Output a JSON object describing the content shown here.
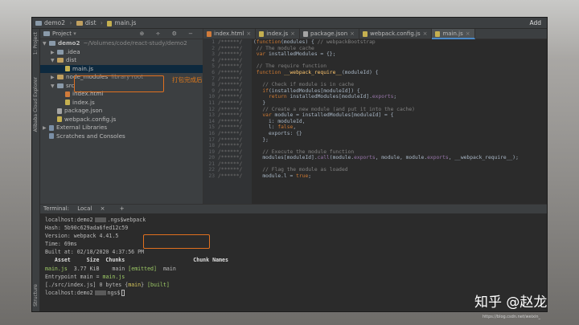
{
  "titlebar": {
    "crumb1": "demo2",
    "crumb2": "dist",
    "crumb3": "main.js",
    "right_label": "Add"
  },
  "leftbar": {
    "label1": "1: Project",
    "label2": "Alibaba Cloud Explorer",
    "label3": "Structure"
  },
  "project": {
    "header_label": "Project",
    "tools": "⊕ ÷ ⚙ −",
    "tree": [
      {
        "indent": 0,
        "arrow": "▼",
        "icon": "folder",
        "label": "demo2",
        "extra": "~/Volumes/code/react-study/demo2",
        "bold": true
      },
      {
        "indent": 1,
        "arrow": "▶",
        "icon": "folder",
        "label": ".idea",
        "extra": ""
      },
      {
        "indent": 1,
        "arrow": "▼",
        "icon": "folder-y",
        "label": "dist",
        "extra": ""
      },
      {
        "indent": 2,
        "arrow": "",
        "icon": "js",
        "label": "main.js",
        "extra": "",
        "selected": true
      },
      {
        "indent": 1,
        "arrow": "▶",
        "icon": "folder-y",
        "label": "node_modules",
        "extra": "library root"
      },
      {
        "indent": 1,
        "arrow": "▼",
        "icon": "folder",
        "label": "src",
        "extra": ""
      },
      {
        "indent": 2,
        "arrow": "",
        "icon": "html",
        "label": "index.html",
        "extra": ""
      },
      {
        "indent": 2,
        "arrow": "",
        "icon": "js",
        "label": "index.js",
        "extra": ""
      },
      {
        "indent": 1,
        "arrow": "",
        "icon": "json",
        "label": "package.json",
        "extra": ""
      },
      {
        "indent": 1,
        "arrow": "",
        "icon": "js",
        "label": "webpack.config.js",
        "extra": ""
      },
      {
        "indent": 0,
        "arrow": "▶",
        "icon": "lib",
        "label": "External Libraries",
        "extra": ""
      },
      {
        "indent": 0,
        "arrow": "",
        "icon": "lib",
        "label": "Scratches and Consoles",
        "extra": ""
      }
    ],
    "annotation": "打包完成后"
  },
  "editor": {
    "tabs": [
      {
        "label": "index.html",
        "active": false
      },
      {
        "label": "index.js",
        "active": false
      },
      {
        "label": "package.json",
        "active": false
      },
      {
        "label": "webpack.config.js",
        "active": false
      },
      {
        "label": "main.js",
        "active": true
      }
    ],
    "gutter_mark": "/******/",
    "lines": [
      {
        "n": "1",
        "code": "(function(modules) { // webpackBootstrap"
      },
      {
        "n": "2",
        "code": " // The module cache"
      },
      {
        "n": "3",
        "code": " var installedModules = {};"
      },
      {
        "n": "4",
        "code": ""
      },
      {
        "n": "5",
        "code": " // The require function"
      },
      {
        "n": "6",
        "code": " function __webpack_require__(moduleId) {"
      },
      {
        "n": "7",
        "code": ""
      },
      {
        "n": "8",
        "code": "   // Check if module is in cache"
      },
      {
        "n": "9",
        "code": "   if(installedModules[moduleId]) {"
      },
      {
        "n": "10",
        "code": "     return installedModules[moduleId].exports;"
      },
      {
        "n": "11",
        "code": "   }"
      },
      {
        "n": "12",
        "code": "   // Create a new module (and put it into the cache)"
      },
      {
        "n": "13",
        "code": "   var module = installedModules[moduleId] = {"
      },
      {
        "n": "14",
        "code": "     i: moduleId,"
      },
      {
        "n": "15",
        "code": "     l: false,"
      },
      {
        "n": "16",
        "code": "     exports: {}"
      },
      {
        "n": "17",
        "code": "   };"
      },
      {
        "n": "18",
        "code": ""
      },
      {
        "n": "19",
        "code": "   // Execute the module function"
      },
      {
        "n": "20",
        "code": "   modules[moduleId].call(module.exports, module, module.exports, __webpack_require__);"
      },
      {
        "n": "21",
        "code": ""
      },
      {
        "n": "22",
        "code": "   // Flag the module as loaded"
      },
      {
        "n": "23",
        "code": "   module.l = true;"
      }
    ]
  },
  "terminal": {
    "tab1": "Terminal:",
    "tab2": "Local",
    "tab_close": "×",
    "tab_add": "+",
    "prompt_host": "localhost:demo2",
    "prompt_suffix": ".ngs$",
    "command": "webpack",
    "hash": "Hash: 5b90c629ada6fed12c59",
    "version": "Version: webpack 4.41.5",
    "time": "Time: 69ms",
    "built": "Built at: 02/18/2020 4:37:56 PM",
    "table_head_left": "   Asset     Size  Chunks",
    "table_head_right": "Chunk Names",
    "asset_name": "main.js",
    "asset_size": "  3.77 KiB",
    "asset_chunk": "    main",
    "asset_emitted": "[emitted]",
    "asset_names": "main",
    "entrypoint_label": "Entrypoint main = ",
    "entrypoint_file": "main.js",
    "src_line_a": "[./src/index.js] 0 bytes {",
    "src_line_chunk": "main",
    "src_line_b": "} ",
    "src_line_built": "[built]",
    "prompt2_suffix": "ngs$"
  },
  "watermark": {
    "brand": "知乎 @赵龙",
    "url": "https://blog.csdn.net/weixin_"
  }
}
